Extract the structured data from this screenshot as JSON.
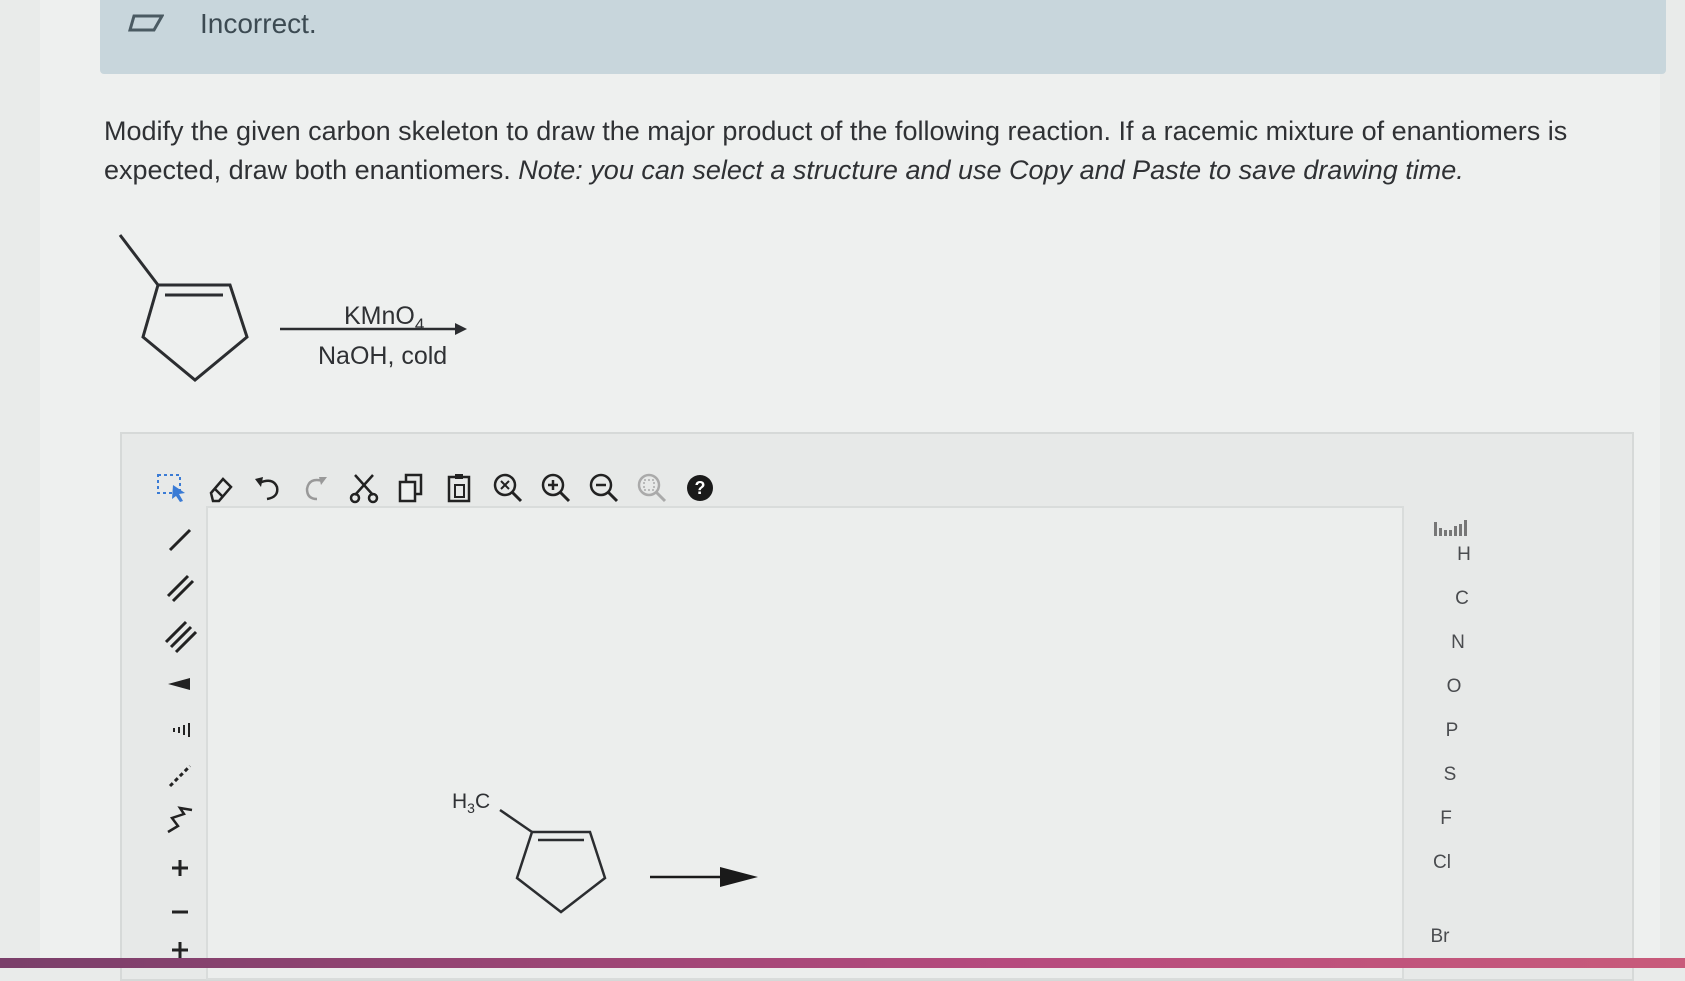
{
  "banner": {
    "text": "Incorrect."
  },
  "question": {
    "text_main": "Modify the given carbon skeleton to draw the major product of the following reaction. If a racemic mixture of enantiomers is expected, draw both enantiomers.",
    "text_note": "Note: you can select a structure and use Copy and Paste to save drawing time."
  },
  "reaction": {
    "reagent_top": "KMnO",
    "reagent_top_sub": "4",
    "reagent_bottom": "NaOH, cold"
  },
  "toolbar": {
    "buttons": [
      "select",
      "erase",
      "undo",
      "redo",
      "cut",
      "copy",
      "paste",
      "zoom-reset",
      "zoom-in",
      "zoom-out",
      "zoom-fit",
      "help"
    ]
  },
  "left_tools": [
    "single-bond",
    "double-bond",
    "triple-bond",
    "wedge-bond",
    "hash-bond",
    "dashed-bond",
    "chain",
    "positive-charge",
    "negative-charge",
    "plus-add"
  ],
  "periodic": {
    "elements": [
      "H",
      "C",
      "N",
      "O",
      "P",
      "S",
      "F",
      "Cl",
      "Br"
    ]
  },
  "canvas": {
    "h3c_main": "H",
    "h3c_sub": "3",
    "h3c_end": "C"
  },
  "colors": {
    "banner": "#c8d6dc",
    "accent_strip": "#b64b7e",
    "help_icon": "#1a1a1a"
  }
}
